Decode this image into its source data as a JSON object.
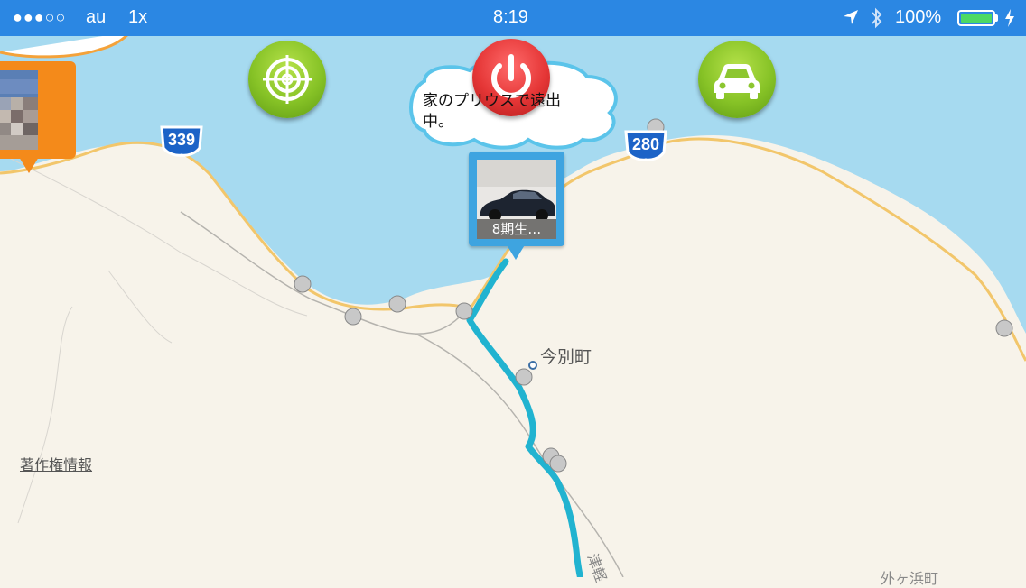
{
  "status_bar": {
    "signal": "●●●○○",
    "carrier": "au",
    "network": "1x",
    "time": "8:19",
    "battery_percent": "100%",
    "battery_level": 1.0
  },
  "toolbar": {
    "location_icon": "crosshair-target-icon",
    "power_icon": "power-icon",
    "car_icon": "car-icon"
  },
  "speech_bubble": {
    "text_line1": "家のプリウスで遠出",
    "text_line2": "中。"
  },
  "car_pin": {
    "caption": "8期生…"
  },
  "map": {
    "town_label": "今別町",
    "copyright_label": "著作権情報",
    "road_labels": [
      "339",
      "280"
    ],
    "bottom_label_1": "津軽",
    "bottom_label_2": "外ヶ浜町"
  },
  "colors": {
    "status_bar": "#2b87e3",
    "sea": "#a6daf0",
    "land": "#f7f3ea",
    "route": "#21b3d0",
    "green_button": "#86c226",
    "red_button": "#e53636",
    "pin_blue": "#3ea4e0",
    "pin_orange": "#f48a1a"
  }
}
